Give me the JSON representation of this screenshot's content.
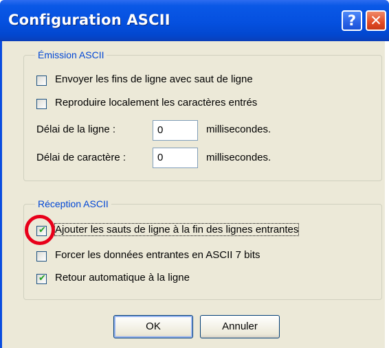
{
  "window": {
    "title": "Configuration ASCII",
    "help_glyph": "?",
    "close_glyph": "✕"
  },
  "emission": {
    "legend": "Émission ASCII",
    "checkboxes": [
      {
        "label": "Envoyer les fins de ligne avec saut de ligne",
        "checked": false
      },
      {
        "label": "Reproduire localement les caractères entrés",
        "checked": false
      }
    ],
    "line_delay": {
      "label": "Délai de la ligne :",
      "value": "0",
      "unit": "millisecondes."
    },
    "char_delay": {
      "label": "Délai de caractère :",
      "value": "0",
      "unit": "millisecondes."
    }
  },
  "reception": {
    "legend": "Réception ASCII",
    "checkboxes": [
      {
        "label": "Ajouter les sauts de ligne à la fin des lignes entrantes",
        "checked": true
      },
      {
        "label": "Forcer les données entrantes en ASCII 7 bits",
        "checked": false
      },
      {
        "label": "Retour automatique à la ligne",
        "checked": true
      }
    ]
  },
  "buttons": {
    "ok": "OK",
    "cancel": "Annuler"
  },
  "check_glyph": "✔",
  "colors": {
    "titlebar": "#0550df",
    "accent_legend": "#0046d5",
    "highlight_circle": "#e8001a",
    "checkmark": "#21a121"
  }
}
